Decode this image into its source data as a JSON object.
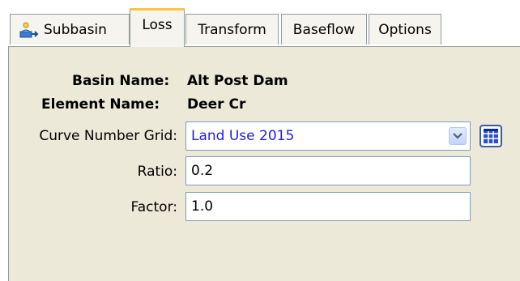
{
  "tabs": [
    {
      "label": "Subbasin",
      "icon": "subbasin-icon"
    },
    {
      "label": "Loss",
      "active": true
    },
    {
      "label": "Transform"
    },
    {
      "label": "Baseflow"
    },
    {
      "label": "Options"
    }
  ],
  "info": {
    "basin_label": "Basin Name:",
    "basin_value": "Alt Post Dam",
    "element_label": "Element Name:",
    "element_value": "Deer Cr"
  },
  "fields": {
    "curve_label": "Curve Number Grid:",
    "curve_value": "Land Use 2015",
    "ratio_label": "Ratio:",
    "ratio_value": "0.2",
    "factor_label": "Factor:",
    "factor_value": "1.0"
  },
  "colors": {
    "active_tab_accent": "#ffc73c",
    "panel_bg": "#ece9d8",
    "dropdown_text": "#1e1ee0"
  }
}
